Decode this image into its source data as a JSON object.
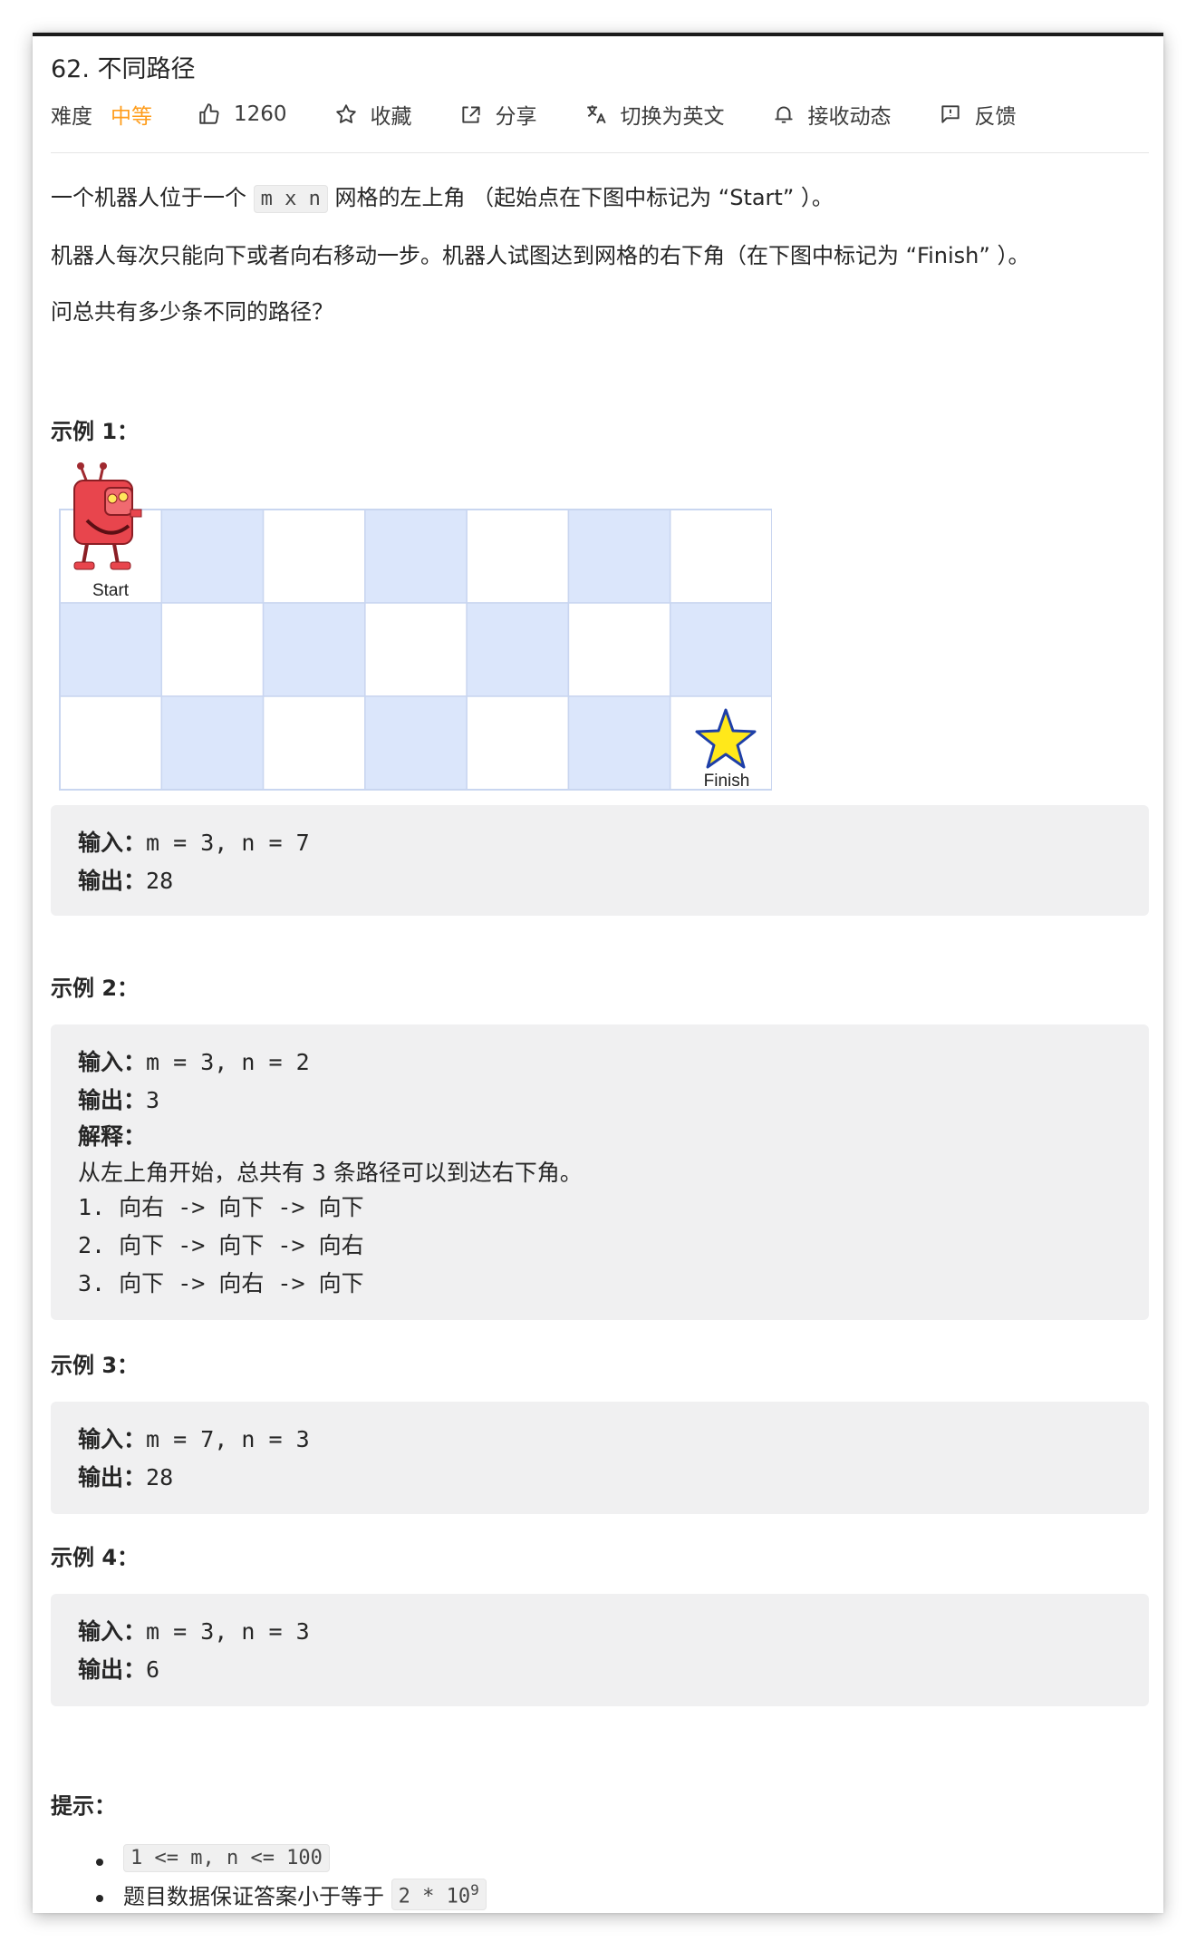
{
  "problem": {
    "title": "62. 不同路径",
    "difficulty_label": "难度",
    "difficulty_value": "中等",
    "likes": "1260",
    "favorite": "收藏",
    "share": "分享",
    "switch_lang": "切换为英文",
    "subscribe": "接收动态",
    "feedback": "反馈"
  },
  "description": {
    "p1_before": "一个机器人位于一个",
    "p1_code": "m x n",
    "p1_after": "网格的左上角 （起始点在下图中标记为 “Start” ）。",
    "p2": "机器人每次只能向下或者向右移动一步。机器人试图达到网格的右下角（在下图中标记为 “Finish” ）。",
    "p3": "问总共有多少条不同的路径？"
  },
  "examples": [
    {
      "heading": "示例 1：",
      "input_label": "输入：",
      "input": "m = 3, n = 7",
      "output_label": "输出：",
      "output": "28"
    },
    {
      "heading": "示例 2：",
      "input_label": "输入：",
      "input": "m = 3, n = 2",
      "output_label": "输出：",
      "output": "3",
      "explain_label": "解释：",
      "explain": "从左上角开始，总共有 3 条路径可以到达右下角。",
      "steps": [
        "1. 向右 -> 向下 -> 向下",
        "2. 向下 -> 向下 -> 向右",
        "3. 向下 -> 向右 -> 向下"
      ]
    },
    {
      "heading": "示例 3：",
      "input_label": "输入：",
      "input": "m = 7, n = 3",
      "output_label": "输出：",
      "output": "28"
    },
    {
      "heading": "示例 4：",
      "input_label": "输入：",
      "input": "m = 3, n = 3",
      "output_label": "输出：",
      "output": "6"
    }
  ],
  "figure": {
    "start_label": "Start",
    "finish_label": "Finish",
    "rows": 3,
    "cols": 7,
    "cell_color_a": "#ffffff",
    "cell_color_b": "#dbe6fb",
    "robot_color": "#e8454d",
    "star_color": "#ffe81a"
  },
  "hints": {
    "heading": "提示：",
    "hint1_code": "1 <= m, n <= 100",
    "hint2_text": "题目数据保证答案小于等于",
    "hint2_code": "2 * 10",
    "hint2_sup": "9"
  },
  "colors": {
    "accent_medium": "#ff9d1c",
    "code_bg": "#f0f0f1",
    "text": "#262626"
  }
}
